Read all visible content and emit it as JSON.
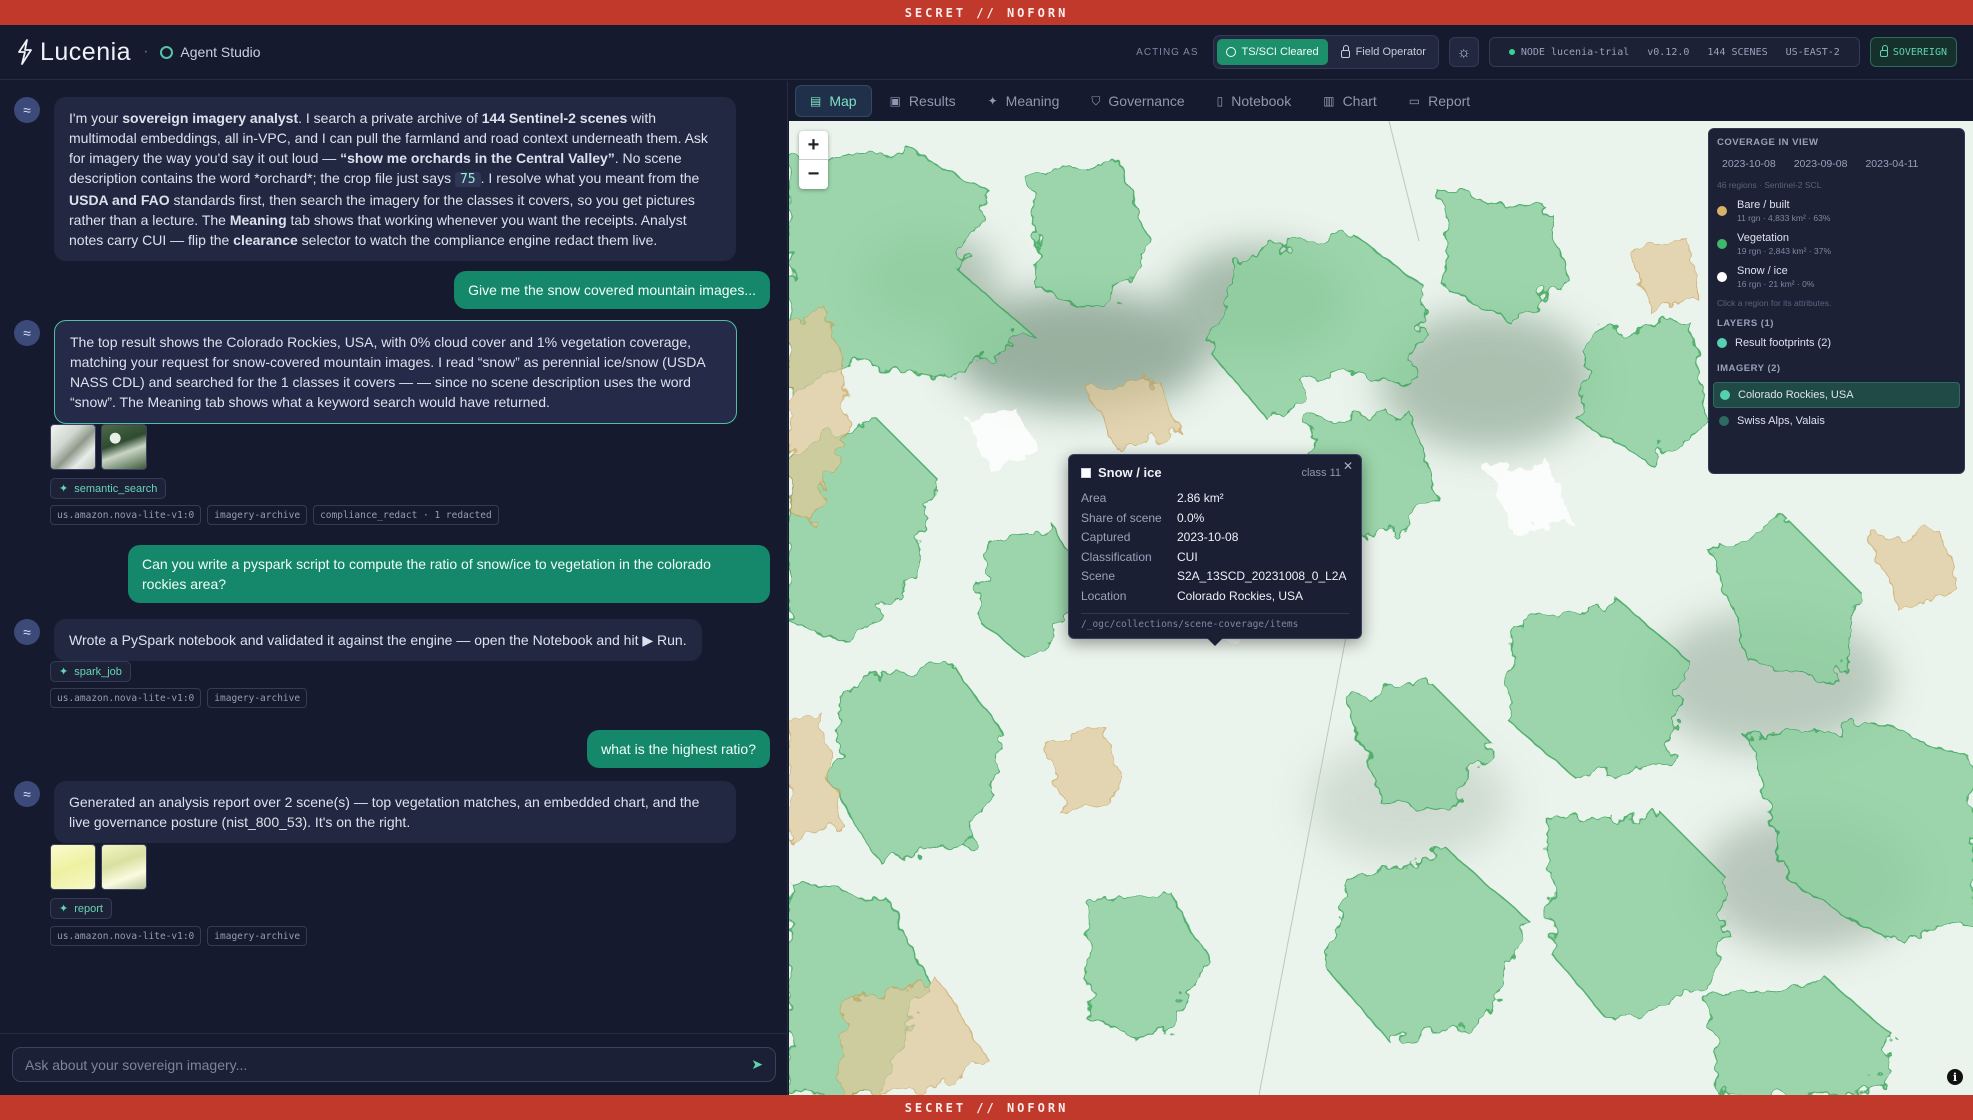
{
  "banner": {
    "text": "SECRET // NOFORN"
  },
  "header": {
    "logo": "Lucenia",
    "studio": "Agent Studio",
    "acting_as": "ACTING AS",
    "clearance_active": "TS/SCI Cleared",
    "clearance_other": "Field Operator",
    "status": {
      "node": "NODE lucenia-trial",
      "version": "v0.12.0",
      "scenes": "144 SCENES",
      "region": "US-EAST-2"
    },
    "sovereign": "SOVEREIGN"
  },
  "chat": {
    "m1": {
      "p1": "I'm your ",
      "b1": "sovereign imagery analyst",
      "p2": ". I search a private archive of ",
      "b2": "144 Sentinel-2 scenes",
      "p3": " with multimodal embeddings, all in-VPC, and I can pull the farmland and road context underneath them. Ask for imagery the way you'd say it out loud — ",
      "b3": "“show me orchards in the Central Valley”",
      "p4": ". No scene description contains the word *orchard*; the crop file just says ",
      "code": "75",
      "p5": ". I resolve what you meant from the ",
      "b4": "USDA and FAO",
      "p6": " standards first, then search the imagery for the classes it covers, so you get pictures rather than a lecture. The ",
      "b5": "Meaning",
      "p7": " tab shows that working whenever you want the receipts. Analyst notes carry CUI — flip the ",
      "b6": "clearance",
      "p8": " selector to watch the compliance engine redact them live."
    },
    "u1": "Give me the snow covered mountain images...",
    "m2": "The top result shows the Colorado Rockies, USA, with 0% cloud cover and 1% vegetation coverage, matching your request for snow-covered mountain images. I read “snow” as perennial ice/snow (USDA NASS CDL) and searched for the 1 classes it covers — — since no scene description uses the word “snow”. The Meaning tab shows what a keyword search would have returned.",
    "tool1": "semantic_search",
    "tags1": [
      "us.amazon.nova-lite-v1:0",
      "imagery-archive",
      "compliance_redact · 1 redacted"
    ],
    "u2": "Can you write a pyspark script to compute the ratio of snow/ice to vegetation in the colorado rockies area?",
    "m3": "Wrote a PySpark notebook and validated it against the engine — open the Notebook and hit ▶ Run.",
    "tool2": "spark_job",
    "tags2": [
      "us.amazon.nova-lite-v1:0",
      "imagery-archive"
    ],
    "u3": "what is the highest ratio?",
    "m4": "Generated an analysis report over 2 scene(s) — top vegetation matches, an embedded chart, and the live governance posture (nist_800_53). It's on the right.",
    "tool3": "report",
    "tags3": [
      "us.amazon.nova-lite-v1:0",
      "imagery-archive"
    ],
    "placeholder": "Ask about your sovereign imagery..."
  },
  "tabs": [
    "Map",
    "Results",
    "Meaning",
    "Governance",
    "Notebook",
    "Chart",
    "Report"
  ],
  "popup": {
    "title": "Snow / ice",
    "class": "class 11",
    "rows": [
      {
        "k": "Area",
        "v": "2.86 km²"
      },
      {
        "k": "Share of scene",
        "v": "0.0%"
      },
      {
        "k": "Captured",
        "v": "2023-10-08"
      },
      {
        "k": "Classification",
        "v": "CUI"
      },
      {
        "k": "Scene",
        "v": "S2A_13SCD_20231008_0_L2A"
      },
      {
        "k": "Location",
        "v": "Colorado Rockies, USA"
      }
    ],
    "footer": "/_ogc/collections/scene-coverage/items"
  },
  "coverage": {
    "title": "COVERAGE IN VIEW",
    "dates": [
      "2023-10-08",
      "2023-09-08",
      "2023-04-11"
    ],
    "sub": "46 regions · Sentinel-2 SCL",
    "classes": [
      {
        "name": "Bare / built",
        "meta": "11 rgn · 4,833 km² · 63%",
        "color": "#d7b36a"
      },
      {
        "name": "Vegetation",
        "meta": "19 rgn · 2,843 km² · 37%",
        "color": "#3fb86a"
      },
      {
        "name": "Snow / ice",
        "meta": "16 rgn · 21 km² · 0%",
        "color": "#ffffff"
      }
    ],
    "hint": "Click a region for its attributes.",
    "layers_title": "LAYERS (1)",
    "layer": "Result footprints (2)",
    "imagery_title": "IMAGERY (2)",
    "imagery": [
      "Colorado Rockies, USA",
      "Swiss Alps, Valais"
    ]
  }
}
